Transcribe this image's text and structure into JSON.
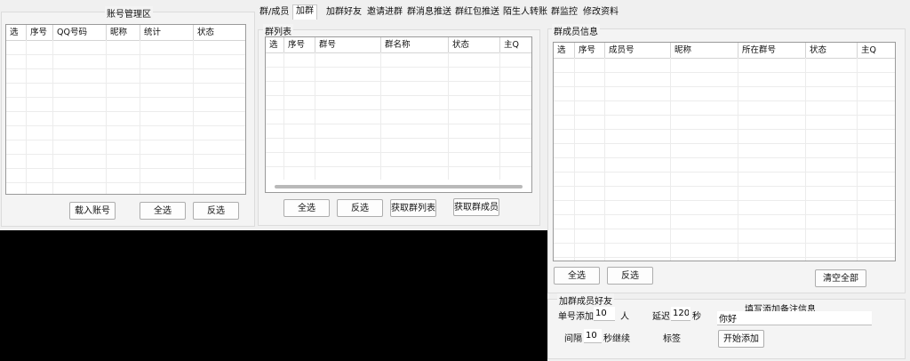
{
  "account": {
    "title": "账号管理区",
    "columns": [
      "选",
      "序号",
      "QQ号码",
      "昵称",
      "统计",
      "状态"
    ],
    "buttons": {
      "load": "载入账号",
      "select_all": "全选",
      "invert": "反选"
    }
  },
  "tabs": [
    {
      "label": "群/成员",
      "active": false
    },
    {
      "label": "加群",
      "active": true
    },
    {
      "label": "加群好友",
      "active": false
    },
    {
      "label": "邀请进群",
      "active": false
    },
    {
      "label": "群消息推送",
      "active": false
    },
    {
      "label": "群红包推送",
      "active": false
    },
    {
      "label": "陌生人转账",
      "active": false
    },
    {
      "label": "群监控",
      "active": false
    },
    {
      "label": "修改资料",
      "active": false
    }
  ],
  "group_list": {
    "title": "群列表",
    "columns": [
      "选",
      "序号",
      "群号",
      "群名称",
      "状态",
      "主Q"
    ],
    "buttons": {
      "select_all": "全选",
      "invert": "反选",
      "fetch_groups": "获取群列表",
      "fetch_members": "获取群成员"
    }
  },
  "members": {
    "title": "群成员信息",
    "columns": [
      "选",
      "序号",
      "成员号",
      "昵称",
      "所在群号",
      "状态",
      "主Q"
    ],
    "buttons": {
      "select_all": "全选",
      "invert": "反选",
      "clear_all": "清空全部"
    }
  },
  "add_friend": {
    "title": "加群成员好友",
    "per_account_label": "单号添加",
    "per_account_value": "10",
    "per_account_unit": "人",
    "delay_label": "延迟",
    "delay_value": "120",
    "delay_unit": "秒",
    "interval_label": "间隔",
    "interval_value": "10",
    "interval_unit": "秒继续",
    "tag_label": "标签",
    "note_label": "填写添加备注信息",
    "note_value": "你好",
    "start_button": "开始添加"
  }
}
